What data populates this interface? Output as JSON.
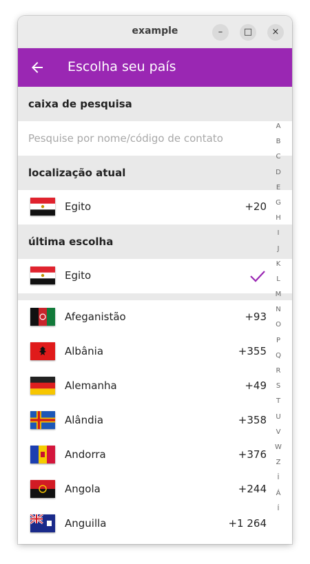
{
  "window": {
    "title": "example",
    "minimize": "–",
    "maximize": "□",
    "close": "×"
  },
  "appbar": {
    "title": "Escolha seu país",
    "back_icon": "arrow-left-icon"
  },
  "sections": {
    "search_header": "caixa de pesquisa",
    "search_placeholder": "Pesquise por nome/código de contato",
    "location_header": "localização atual",
    "last_choice_header": "última escolha"
  },
  "current_location": {
    "name": "Egito",
    "code": "+20"
  },
  "last_choice": {
    "name": "Egito",
    "selected": true
  },
  "countries": [
    {
      "name": "Afeganistão",
      "code": "+93"
    },
    {
      "name": "Albânia",
      "code": "+355"
    },
    {
      "name": "Alemanha",
      "code": "+49"
    },
    {
      "name": "Alândia",
      "code": "+358"
    },
    {
      "name": "Andorra",
      "code": "+376"
    },
    {
      "name": "Angola",
      "code": "+244"
    },
    {
      "name": "Anguilla",
      "code": "+1 264"
    }
  ],
  "alphabet_index": [
    "A",
    "B",
    "C",
    "D",
    "E",
    "G",
    "H",
    "I",
    "J",
    "K",
    "L",
    "M",
    "N",
    "O",
    "P",
    "Q",
    "R",
    "S",
    "T",
    "U",
    "V",
    "W",
    "Z",
    "İ",
    "Á",
    "Í"
  ],
  "colors": {
    "accent": "#9a27b3",
    "header_bg": "#e9e9e9"
  }
}
